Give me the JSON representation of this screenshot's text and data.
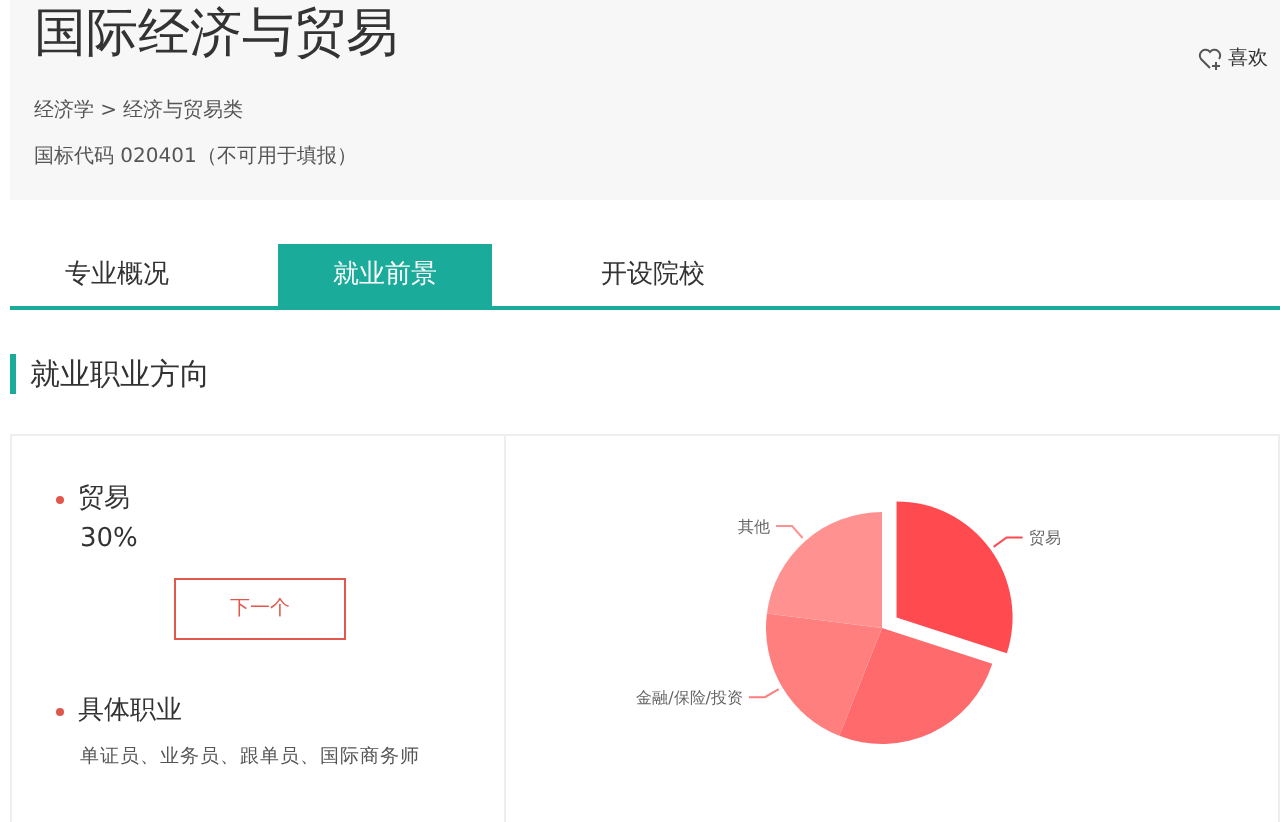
{
  "header": {
    "title": "国际经济与贸易",
    "breadcrumb": "经济学 > 经济与贸易类",
    "code": "国标代码 020401（不可用于填报）",
    "like": "喜欢"
  },
  "tabs": [
    {
      "label": "专业概况",
      "selected": false
    },
    {
      "label": "就业前景",
      "selected": true
    },
    {
      "label": "开设院校",
      "selected": false
    }
  ],
  "section_title": "就业职业方向",
  "direction": {
    "name": "贸易",
    "share": "30%",
    "next_button": "下一个"
  },
  "jobs": {
    "title": "具体职业",
    "list": "单证员、业务员、跟单员、国际商务师"
  },
  "chart_data": {
    "type": "pie",
    "categories": [
      "贸易",
      null,
      "金融/保险/投资",
      "其他"
    ],
    "series": [
      {
        "values": [
          30,
          26,
          21,
          23
        ],
        "colors": [
          "#ff4a4f",
          "#ff6a6c",
          "#ff7e7e",
          "#ff9290"
        ]
      }
    ]
  }
}
